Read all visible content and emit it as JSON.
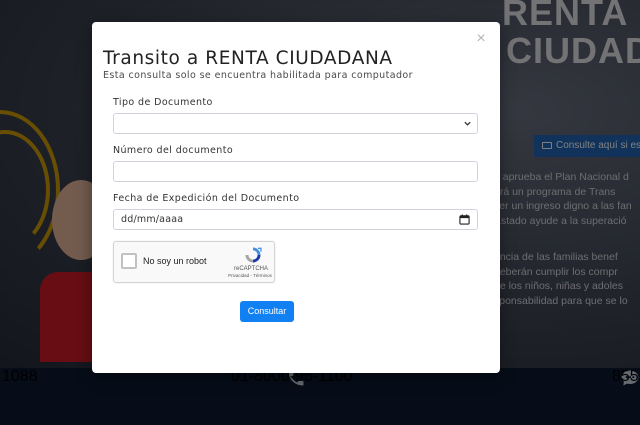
{
  "background": {
    "brand_line1": "RENTA",
    "brand_line2": "CIUDADANA",
    "cta_label": "Consulte aquí si esta",
    "text_lines_a": [
      "e aprueba el Plan Nacional d",
      "ará un programa de Trans",
      "cer un ingreso digno a las fan",
      "Estado ayude a la superació"
    ],
    "text_lines_b": [
      "encia de las familias benef",
      "deberán cumplir los compr",
      "de los niños, niñas y adoles",
      "sponsabilidad para que se lo"
    ],
    "footer_numbers": [
      "1088",
      "01-8000-95-1100",
      "855"
    ],
    "colors": {
      "cta": "#2267b7",
      "footer": "#0c1b31",
      "accent_gold": "#e1a800"
    }
  },
  "modal": {
    "title": "Transito a RENTA CIUDADANA",
    "subtitle": "Esta consulta solo se encuentra habilitada para computador",
    "close_icon": "close-icon",
    "fields": {
      "tipo_documento": {
        "label": "Tipo de Documento",
        "value": ""
      },
      "numero_documento": {
        "label": "Número del documento",
        "value": ""
      },
      "fecha_expedicion": {
        "label": "Fecha de Expedición del Documento",
        "placeholder": "dd/mm/aaaa"
      }
    },
    "captcha": {
      "label": "No soy un robot",
      "brand": "reCAPTCHA",
      "links": "Privacidad - Términos"
    },
    "submit_label": "Consultar",
    "colors": {
      "primary": "#1180f3"
    }
  }
}
